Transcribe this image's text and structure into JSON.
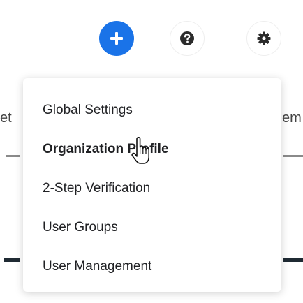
{
  "header": {
    "add_icon": "plus-circle-icon",
    "help_icon": "question-circle-icon",
    "settings_icon": "gear-icon",
    "accent_color": "#1a73e8"
  },
  "background": {
    "left_fragment": "et",
    "right_fragment": "em"
  },
  "settings_menu": {
    "items": [
      {
        "label": "Global Settings",
        "active": false
      },
      {
        "label": "Organization Profile",
        "active": true
      },
      {
        "label": "2-Step Verification",
        "active": false
      },
      {
        "label": "User Groups",
        "active": false
      },
      {
        "label": "User Management",
        "active": false
      }
    ]
  },
  "cursor": {
    "icon": "hand-pointer-icon"
  }
}
